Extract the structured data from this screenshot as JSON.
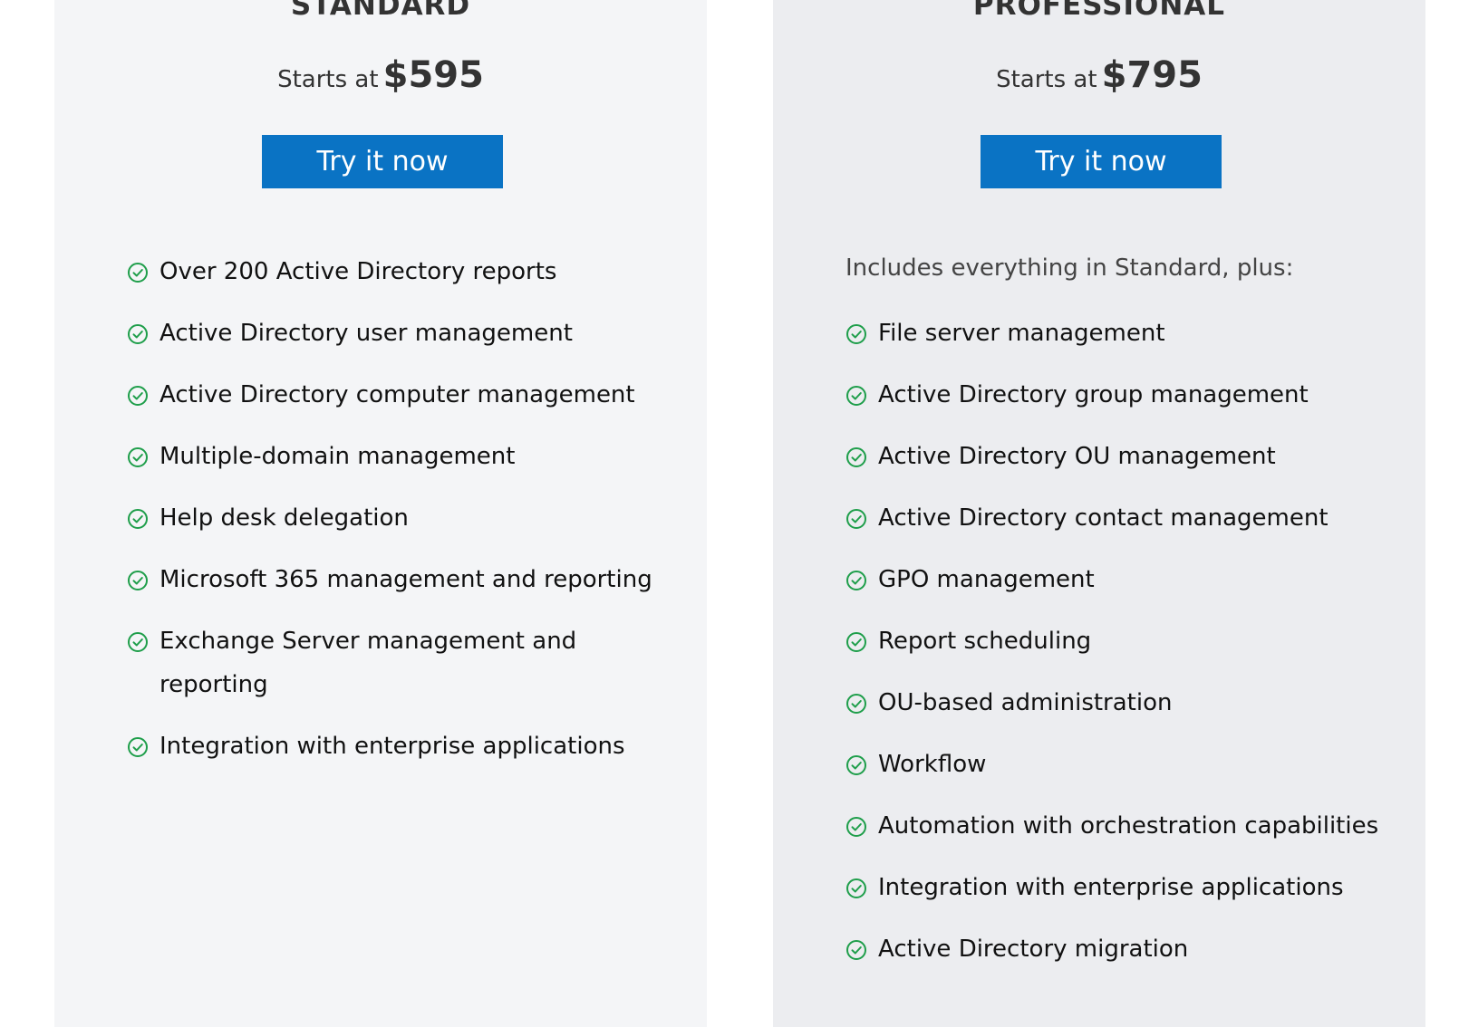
{
  "colors": {
    "accent": "#0a73c4",
    "check": "#1e9e4a",
    "standard_bg": "#f4f5f7",
    "professional_bg": "#ecedf0"
  },
  "plans": [
    {
      "name": "STANDARD",
      "price_prefix": "Starts at",
      "price": "$595",
      "cta_label": "Try it now",
      "intro": "",
      "features": [
        "Over 200 Active Directory reports",
        "Active Directory user management",
        "Active Directory computer management",
        "Multiple-domain management",
        "Help desk delegation",
        "Microsoft 365 management and reporting",
        "Exchange Server management and reporting",
        "Integration with enterprise applications"
      ]
    },
    {
      "name": "PROFESSIONAL",
      "price_prefix": "Starts at",
      "price": "$795",
      "cta_label": "Try it now",
      "intro": "Includes everything in Standard, plus:",
      "features": [
        "File server management",
        "Active Directory group management",
        "Active Directory OU management",
        "Active Directory contact management",
        "GPO management",
        "Report scheduling",
        "OU-based administration",
        "Workflow",
        "Automation with orchestration capabilities",
        "Integration with enterprise applications",
        "Active Directory migration"
      ]
    }
  ],
  "icons": {
    "feature_bullet": "check-circle-icon"
  }
}
